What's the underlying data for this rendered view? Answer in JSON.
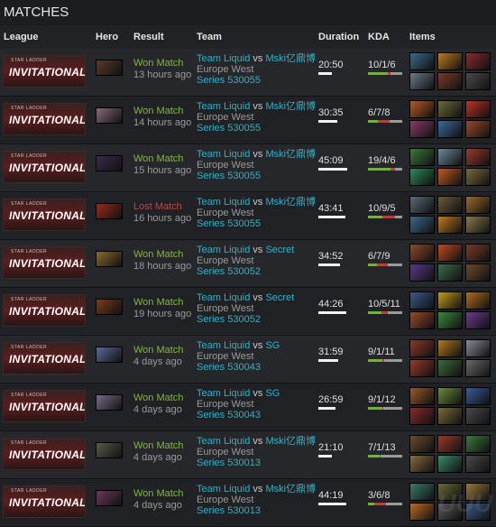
{
  "page_title": "MATCHES",
  "columns": {
    "league": "League",
    "hero": "Hero",
    "result": "Result",
    "team": "Team",
    "duration": "Duration",
    "kda": "KDA",
    "items": "Items"
  },
  "league_logo": {
    "small": "STAR LADDER",
    "text": "INVITATIONAL"
  },
  "watermark": "UUU",
  "matches": [
    {
      "hero_color": "#5a3a2a",
      "result": "Won Match",
      "won": true,
      "ago": "13 hours ago",
      "team1": "Team Liquid",
      "vs": "vs",
      "team2": "Mski亿鼎博",
      "region": "Europe West",
      "series": "Series 530055",
      "duration": "20:50",
      "duration_frac": 0.35,
      "kda": "10/1/6",
      "k": 10,
      "d": 1,
      "a": 6,
      "items": [
        "#3a6a8a",
        "#c07a20",
        "#8a2a2a",
        "#6a7a8a",
        "#7a3a2a",
        "#4a4a4a"
      ]
    },
    {
      "hero_color": "#8a6a7a",
      "result": "Won Match",
      "won": true,
      "ago": "14 hours ago",
      "team1": "Team Liquid",
      "vs": "vs",
      "team2": "Mski亿鼎博",
      "region": "Europe West",
      "series": "Series 530055",
      "duration": "30:35",
      "duration_frac": 0.5,
      "kda": "6/7/8",
      "k": 6,
      "d": 7,
      "a": 8,
      "items": [
        "#b85a20",
        "#6a6a3a",
        "#c03020",
        "#8a3a6a",
        "#3a6a9a",
        "#9a4a2a"
      ]
    },
    {
      "hero_color": "#3a2a4a",
      "result": "Won Match",
      "won": true,
      "ago": "15 hours ago",
      "team1": "Team Liquid",
      "vs": "vs",
      "team2": "Mski亿鼎博",
      "region": "Europe West",
      "series": "Series 530055",
      "duration": "45:09",
      "duration_frac": 0.75,
      "kda": "19/4/6",
      "k": 19,
      "d": 4,
      "a": 6,
      "items": [
        "#3a7a3a",
        "#6a8a9a",
        "#9a3a2a",
        "#2a8a5a",
        "#c05a20",
        "#7a6a3a"
      ]
    },
    {
      "hero_color": "#9a2a1a",
      "result": "Lost Match",
      "won": false,
      "ago": "16 hours ago",
      "team1": "Team Liquid",
      "vs": "vs",
      "team2": "Mski亿鼎博",
      "region": "Europe West",
      "series": "Series 530055",
      "duration": "43:41",
      "duration_frac": 0.72,
      "kda": "10/9/5",
      "k": 10,
      "d": 9,
      "a": 5,
      "items": [
        "#5a6a7a",
        "#6a5a3a",
        "#9a6a2a",
        "#3a6a8a",
        "#c07a20",
        "#8a7a4a"
      ]
    },
    {
      "hero_color": "#8a6a2a",
      "result": "Won Match",
      "won": true,
      "ago": "18 hours ago",
      "team1": "Team Liquid",
      "vs": "vs",
      "team2": "Secret",
      "region": "Europe West",
      "series": "Series 530052",
      "duration": "34:52",
      "duration_frac": 0.58,
      "kda": "6/7/9",
      "k": 6,
      "d": 7,
      "a": 9,
      "items": [
        "#8a4a2a",
        "#c04a20",
        "#7a3a2a",
        "#5a3a8a",
        "#3a6a4a",
        "#6a4a2a"
      ]
    },
    {
      "hero_color": "#7a3a1a",
      "result": "Won Match",
      "won": true,
      "ago": "19 hours ago",
      "team1": "Team Liquid",
      "vs": "vs",
      "team2": "Secret",
      "region": "Europe West",
      "series": "Series 530052",
      "duration": "44:26",
      "duration_frac": 0.74,
      "kda": "10/5/11",
      "k": 10,
      "d": 5,
      "a": 11,
      "items": [
        "#3a5a8a",
        "#c09a20",
        "#b06a20",
        "#9a4a2a",
        "#3a8a3a",
        "#6a3a8a"
      ]
    },
    {
      "hero_color": "#5a6a9a",
      "result": "Won Match",
      "won": true,
      "ago": "4 days ago",
      "team1": "Team Liquid",
      "vs": "vs",
      "team2": "SG",
      "region": "Europe West",
      "series": "Series 530043",
      "duration": "31:59",
      "duration_frac": 0.53,
      "kda": "9/1/11",
      "k": 9,
      "d": 1,
      "a": 11,
      "items": [
        "#8a3a2a",
        "#b07a20",
        "#8a8a9a",
        "#9a3a2a",
        "#3a6a3a",
        "#6a6a6a"
      ]
    },
    {
      "hero_color": "#7a6a8a",
      "result": "Won Match",
      "won": true,
      "ago": "4 days ago",
      "team1": "Team Liquid",
      "vs": "vs",
      "team2": "SG",
      "region": "Europe West",
      "series": "Series 530043",
      "duration": "26:59",
      "duration_frac": 0.45,
      "kda": "9/1/12",
      "k": 9,
      "d": 1,
      "a": 12,
      "items": [
        "#9a5a2a",
        "#6a8a3a",
        "#3a5a9a",
        "#8a2a2a",
        "#7a6a3a",
        "#4a4a4a"
      ]
    },
    {
      "hero_color": "#5a5a4a",
      "result": "Won Match",
      "won": true,
      "ago": "4 days ago",
      "team1": "Team Liquid",
      "vs": "vs",
      "team2": "Mski亿鼎博",
      "region": "Europe West",
      "series": "Series 530013",
      "duration": "21:10",
      "duration_frac": 0.35,
      "kda": "7/1/13",
      "k": 7,
      "d": 1,
      "a": 13,
      "items": [
        "#6a4a2a",
        "#9a3a2a",
        "#3a7a3a",
        "#8a6a3a",
        "#3a8a6a",
        "#4a4a4a"
      ]
    },
    {
      "hero_color": "#6a3a5a",
      "result": "Won Match",
      "won": true,
      "ago": "4 days ago",
      "team1": "Team Liquid",
      "vs": "vs",
      "team2": "Mski亿鼎博",
      "region": "Europe West",
      "series": "Series 530013",
      "duration": "44:19",
      "duration_frac": 0.74,
      "kda": "3/6/8",
      "k": 3,
      "d": 6,
      "a": 8,
      "items": [
        "#3a7a6a",
        "#6a6a3a",
        "#9a7a3a",
        "#c06a20",
        "#5a5a5a",
        "#3a5a8a"
      ]
    }
  ]
}
